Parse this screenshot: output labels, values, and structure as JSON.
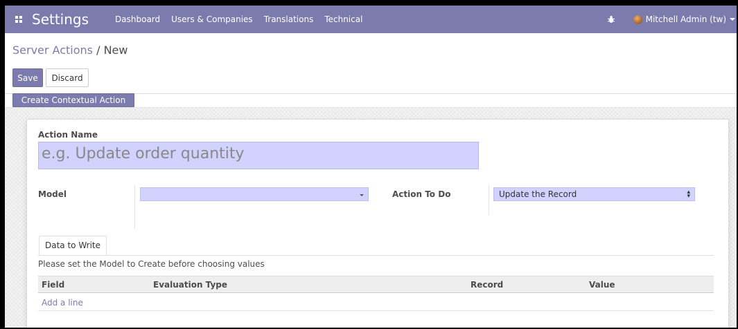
{
  "topbar": {
    "app_title": "Settings",
    "menu": [
      {
        "label": "Dashboard"
      },
      {
        "label": "Users & Companies"
      },
      {
        "label": "Translations"
      },
      {
        "label": "Technical"
      }
    ],
    "user_name": "Mitchell Admin (tw)",
    "icons": {
      "apps": "apps-grid-icon",
      "debug": "bug-icon",
      "user_menu": "chevron-down-icon"
    },
    "colors": {
      "brand": "#7c7bad"
    }
  },
  "control_panel": {
    "breadcrumb_parent": "Server Actions",
    "breadcrumb_separator": "/",
    "breadcrumb_current": "New",
    "save_label": "Save",
    "discard_label": "Discard"
  },
  "statusbar": {
    "contextual_action_label": "Create Contextual Action"
  },
  "form": {
    "action_name_label": "Action Name",
    "action_name_placeholder": "e.g. Update order quantity",
    "action_name_value": "",
    "model_label": "Model",
    "model_value": "",
    "action_to_do_label": "Action To Do",
    "action_to_do_value": "Update the Record",
    "colors": {
      "required_field": "#d2d2ff"
    }
  },
  "notebook": {
    "tabs": [
      {
        "label": "Data to Write"
      }
    ],
    "note": "Please set the Model to Create before choosing values",
    "table": {
      "columns": [
        "Field",
        "Evaluation Type",
        "Record",
        "Value"
      ],
      "add_line_label": "Add a line"
    }
  }
}
